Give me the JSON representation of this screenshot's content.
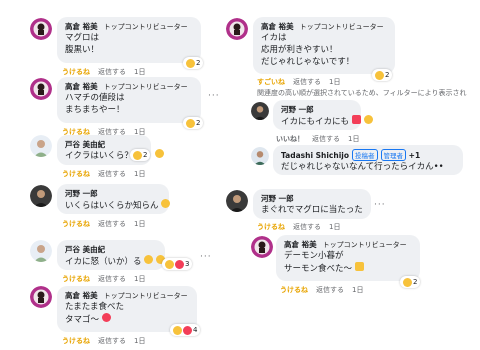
{
  "actions": {
    "like": "うけるね",
    "reply": "返信する",
    "time": "1日",
    "love": "いいね！"
  },
  "c1": {
    "name": "高倉 裕美",
    "badge": "トップコントリビューター",
    "lines": [
      "マグロは",
      "腹黒い！"
    ],
    "count": "2"
  },
  "c2": {
    "name": "高倉 裕美",
    "badge": "トップコントリビューター",
    "lines": [
      "ハマチの値段は",
      "まちまちやー！"
    ],
    "count": "2"
  },
  "c3": {
    "name": "戸谷 美由紀",
    "lines": [
      "イクラはいくら？"
    ],
    "count": "2"
  },
  "c4": {
    "name": "河野 一郎",
    "lines": [
      "いくらはいくらか知らん"
    ]
  },
  "c5": {
    "name": "戸谷 美由紀",
    "lines": [
      "イカに怒（いか）る"
    ],
    "count": "3"
  },
  "c6": {
    "name": "高倉 裕美",
    "badge": "トップコントリビューター",
    "lines": [
      "たまたま食べた",
      "タマゴ〜"
    ],
    "count": "4"
  },
  "r1": {
    "name": "高倉 裕美",
    "badge": "トップコントリビューター",
    "lines": [
      "イカは",
      "応用が利きやすい！",
      "だじゃれじゃないです！"
    ],
    "action_like": "すごいね",
    "count": "2"
  },
  "info_text": "関連度の高い順が選択されているため、フィルターにより表示され",
  "r2": {
    "name": "河野 一郎",
    "lines": [
      "イカにもイカにも"
    ]
  },
  "r3": {
    "name": "Tadashi Shichijo",
    "pill1": "投稿者",
    "pill2": "管理者",
    "extra": "+1",
    "lines": [
      "だじゃれじゃないなんて行ったらイカん"
    ]
  },
  "r4": {
    "name": "河野 一郎",
    "lines": [
      "まぐれでマグロに当たった"
    ]
  },
  "r5": {
    "name": "高倉 裕美",
    "badge": "トップコントリビューター",
    "lines": [
      "デーモン小暮が",
      "サーモン食べた〜"
    ],
    "count": "2"
  },
  "colors": {
    "bubble": "#eef0f3",
    "like": "#e8a400",
    "link": "#1877f2"
  }
}
